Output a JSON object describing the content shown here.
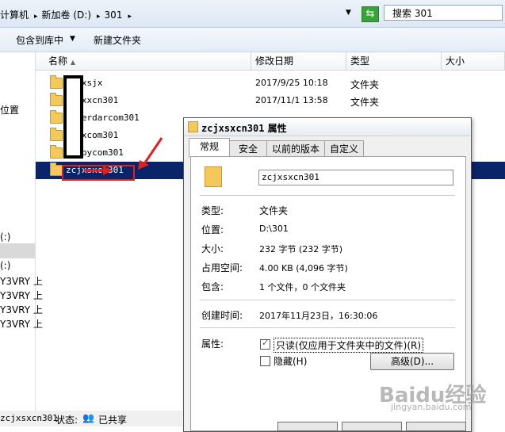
{
  "breadcrumb": [
    "计算机",
    "新加卷 (D:)",
    "301"
  ],
  "search": {
    "placeholder": "搜索 301"
  },
  "toolbar": {
    "include_label": "包含到库中",
    "new_folder_label": "新建文件夹"
  },
  "nav": {
    "items": [
      "位置",
      "(:)",
      "(:)",
      "Y3VRY 上",
      "Y3VRY 上",
      "Y3VRY 上",
      "Y3VRY 上"
    ]
  },
  "columns": {
    "name": "名称",
    "date": "修改日期",
    "type": "类型",
    "size": "大小"
  },
  "files": [
    {
      "name": "zcjxsjx",
      "date": "2017/9/25 10:18",
      "type": "文件夹"
    },
    {
      "name": "dlmxxcn301",
      "date": "2017/11/1 13:58",
      "type": "文件夹"
    },
    {
      "name": "zgherdarcom301",
      "date": "",
      "type": ""
    },
    {
      "name": "ckmxcom301",
      "date": "",
      "type": ""
    },
    {
      "name": "zoobycom301",
      "date": "",
      "type": ""
    },
    {
      "name": "zcjxsxcn301",
      "date": "",
      "type": "",
      "selected": true
    }
  ],
  "dialog": {
    "title_name": "zcjxsxcn301",
    "title_suffix": "属性",
    "tabs": [
      "常规",
      "安全",
      "以前的版本",
      "自定义"
    ],
    "folder_name": "zcjxsxcn301",
    "props": [
      {
        "label": "类型:",
        "value": "文件夹"
      },
      {
        "label": "位置:",
        "value": "D:\\301"
      },
      {
        "label": "大小:",
        "value": "232 字节 (232 字节)"
      },
      {
        "label": "占用空间:",
        "value": "4.00 KB (4,096 字节)"
      },
      {
        "label": "包含:",
        "value": "1 个文件，0 个文件夹"
      },
      {
        "label": "创建时间:",
        "value": "2017年11月23日，16:30:06"
      }
    ],
    "attributes_label": "属性:",
    "readonly_label": "只读(仅应用于文件夹中的文件)(R)",
    "readonly_checked": true,
    "hidden_label": "隐藏(H)",
    "hidden_checked": false,
    "advanced_label": "高级(D)..."
  },
  "status": {
    "name": "zcjxsxcn301",
    "state_label": "状态:",
    "state_value": "已共享"
  },
  "watermark": {
    "brand": "Baidu经验",
    "url": "jingyan.baidu.com"
  },
  "colors": {
    "selection": "#0a246a",
    "annotation": "#e02020"
  }
}
